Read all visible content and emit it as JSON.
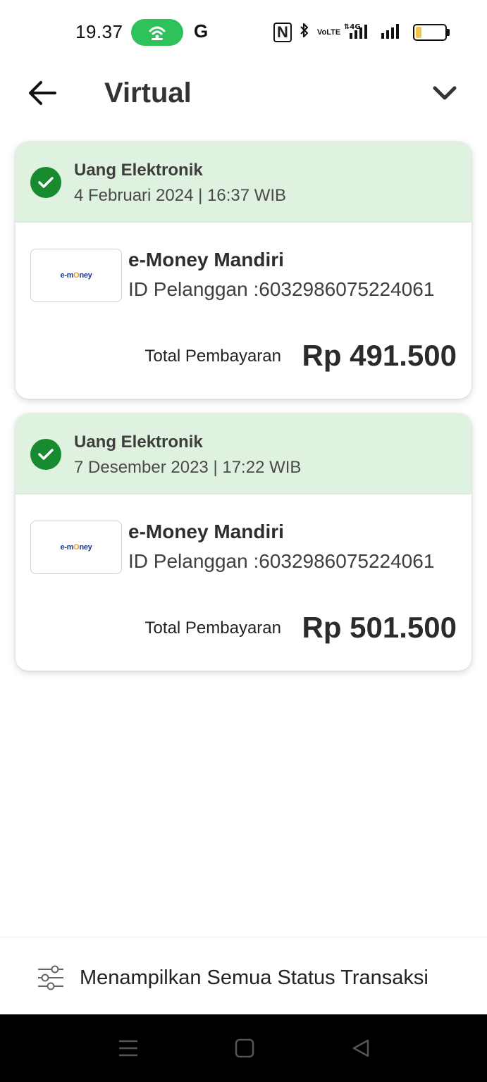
{
  "status_bar": {
    "time": "19.37",
    "carrier_icon": "G",
    "nfc_label": "N",
    "volte_label": "VoLTE",
    "icons": [
      "hotspot-icon",
      "nfc-icon",
      "bluetooth-icon",
      "volte-icon",
      "signal-4g-icon",
      "signal-icon",
      "battery-icon"
    ],
    "battery_level": 0.2,
    "colors": {
      "hotspot": "#2fc25b",
      "battery_fill": "#f3c64a"
    }
  },
  "header": {
    "title": "Virtual",
    "back_icon": "arrow-left-icon",
    "dropdown_icon": "chevron-down-icon"
  },
  "transactions": [
    {
      "category": "Uang Elektronik",
      "datetime": "4 Februari 2024 | 16:37 WIB",
      "logo_text": "e-mOney",
      "product": "e-Money Mandiri",
      "customer_id": "ID Pelanggan :6032986075224061",
      "total_label": "Total Pembayaran",
      "total_amount": "Rp 491.500",
      "status_icon": "check-circle-icon"
    },
    {
      "category": "Uang Elektronik",
      "datetime": "7 Desember 2023 | 17:22 WIB",
      "logo_text": "e-mOney",
      "product": "e-Money Mandiri",
      "customer_id": "ID Pelanggan :6032986075224061",
      "total_label": "Total Pembayaran",
      "total_amount": "Rp 501.500",
      "status_icon": "check-circle-icon"
    }
  ],
  "filter_bar": {
    "label": "Menampilkan Semua Status Transaksi",
    "icon": "sliders-icon"
  },
  "nav_bar": {
    "icons": [
      "menu-icon",
      "home-square-icon",
      "back-triangle-icon"
    ]
  },
  "colors": {
    "card_header_bg": "#dff2df",
    "check_green": "#188a2f"
  }
}
